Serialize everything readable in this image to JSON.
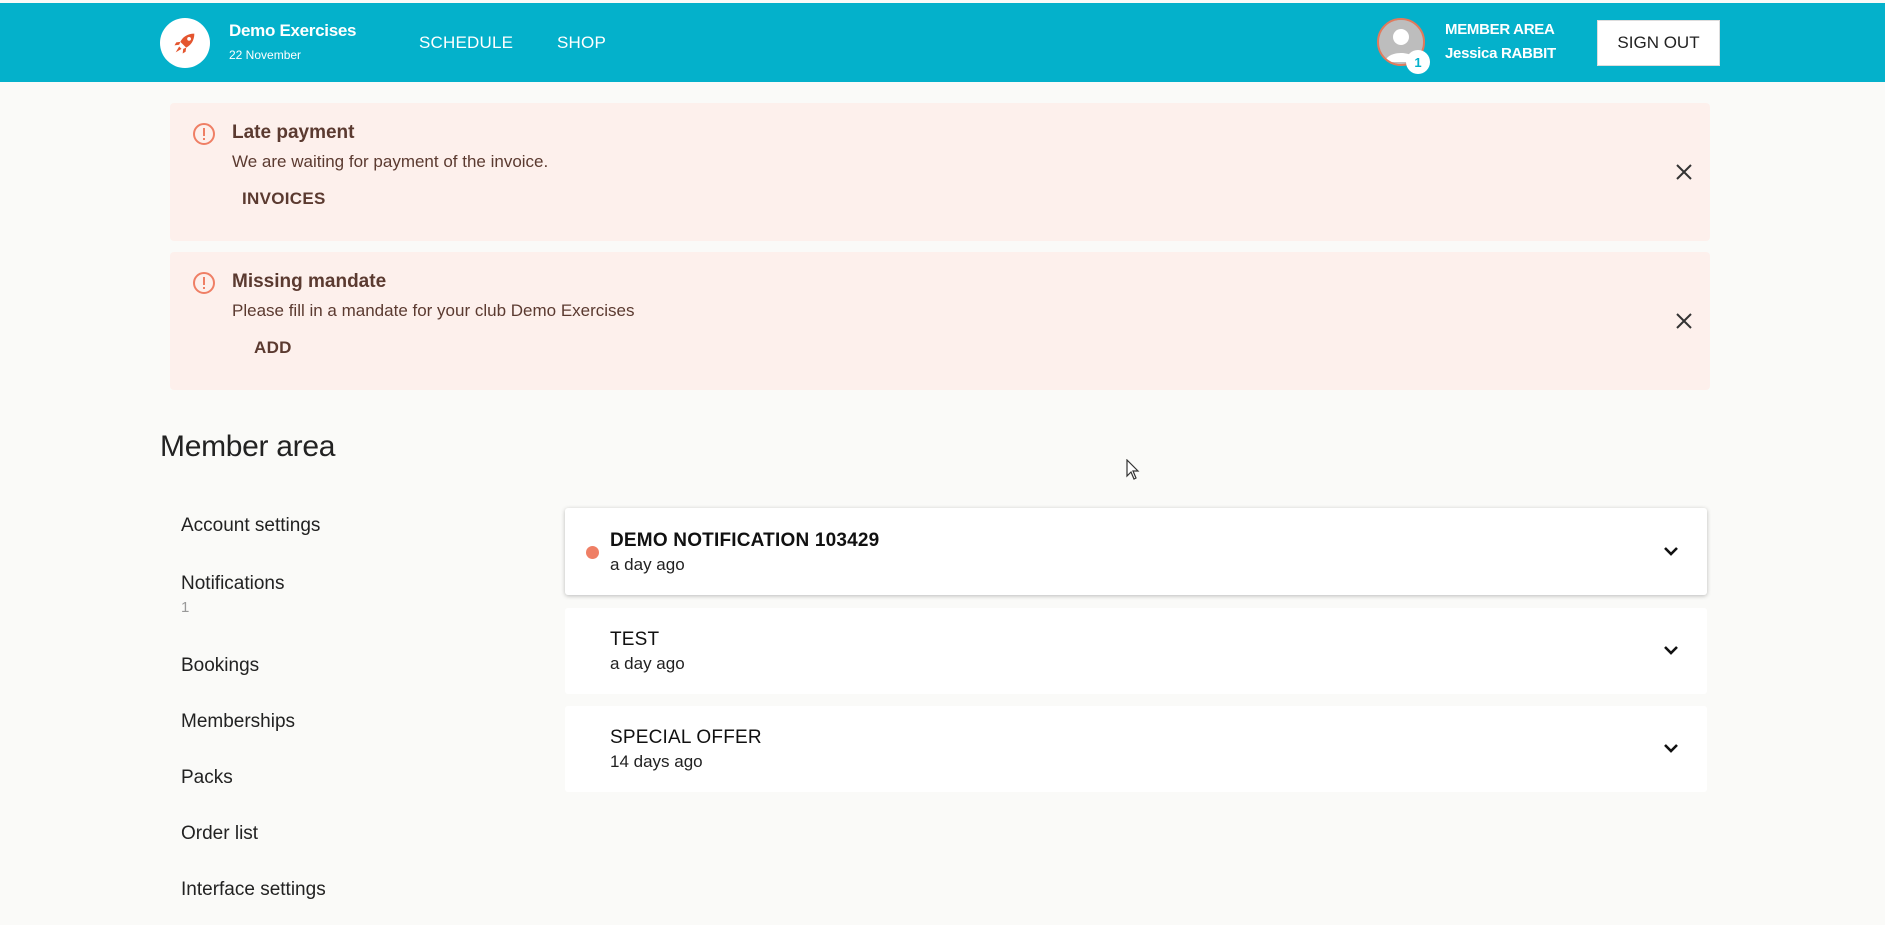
{
  "colors": {
    "topbar": "#04b1cb",
    "alert_bg": "#fdf0ec",
    "accent": "#ef7f65",
    "alert_text": "#5b3a30"
  },
  "header": {
    "logo_icon": "rocket-icon",
    "brand_name": "Demo Exercises",
    "brand_date": "22 November",
    "nav": [
      {
        "label": "SCHEDULE"
      },
      {
        "label": "SHOP"
      }
    ],
    "avatar_icon": "user-avatar-icon",
    "avatar_badge": "1",
    "member_area_label": "MEMBER AREA",
    "member_name": "Jessica RABBIT",
    "sign_out_label": "SIGN OUT"
  },
  "alerts": [
    {
      "icon": "warning-circle-icon",
      "title": "Late payment",
      "message": "We are waiting for payment of the invoice.",
      "action": "INVOICES",
      "close_icon": "close-icon"
    },
    {
      "icon": "warning-circle-icon",
      "title": "Missing mandate",
      "message": "Please fill in a mandate for your club Demo Exercises",
      "action": "ADD",
      "close_icon": "close-icon"
    }
  ],
  "main": {
    "title": "Member area",
    "sidebar": [
      {
        "label": "Account settings"
      },
      {
        "label": "Notifications",
        "count": "1"
      },
      {
        "label": "Bookings"
      },
      {
        "label": "Memberships"
      },
      {
        "label": "Packs"
      },
      {
        "label": "Order list"
      },
      {
        "label": "Interface settings"
      }
    ],
    "notifications": [
      {
        "title": "DEMO NOTIFICATION 103429",
        "time": "a day ago",
        "unread": true
      },
      {
        "title": "TEST",
        "time": "a day ago",
        "unread": false
      },
      {
        "title": "SPECIAL OFFER",
        "time": "14 days ago",
        "unread": false
      }
    ]
  }
}
